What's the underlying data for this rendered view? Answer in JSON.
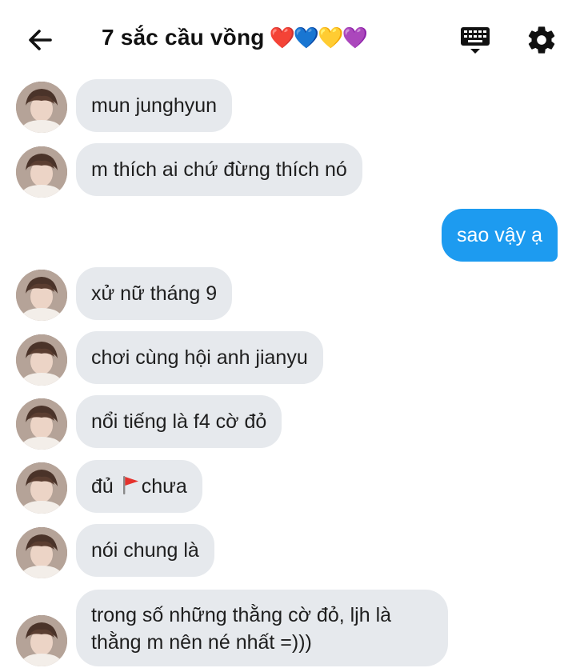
{
  "header": {
    "title": "7 sắc cầu vồng",
    "title_emoji": "❤️💙💛💜",
    "back_icon": "arrow-left-icon",
    "keyboard_icon": "keyboard-icon",
    "settings_icon": "gear-icon"
  },
  "colors": {
    "sent_bubble": "#1d9bf0",
    "received_bubble": "#e6e9ed",
    "text": "#1e1e1e"
  },
  "messages": [
    {
      "from": "them",
      "text": "mun junghyun"
    },
    {
      "from": "them",
      "text": "m thích ai chứ đừng thích nó"
    },
    {
      "from": "me",
      "text": "sao vậy ạ"
    },
    {
      "from": "them",
      "text": "xử nữ tháng 9"
    },
    {
      "from": "them",
      "text": "chơi cùng hội anh jianyu"
    },
    {
      "from": "them",
      "text": "nổi tiếng là f4 cờ đỏ"
    },
    {
      "from": "them",
      "text_before_flag": "đủ",
      "flag_icon": "red-flag-icon",
      "text_after_flag": "chưa"
    },
    {
      "from": "them",
      "text": "nói chung là"
    },
    {
      "from": "them",
      "text_line1": "trong số những thằng cờ đỏ, ljh là",
      "text_line2": "thằng m nên né nhất =)))"
    }
  ]
}
